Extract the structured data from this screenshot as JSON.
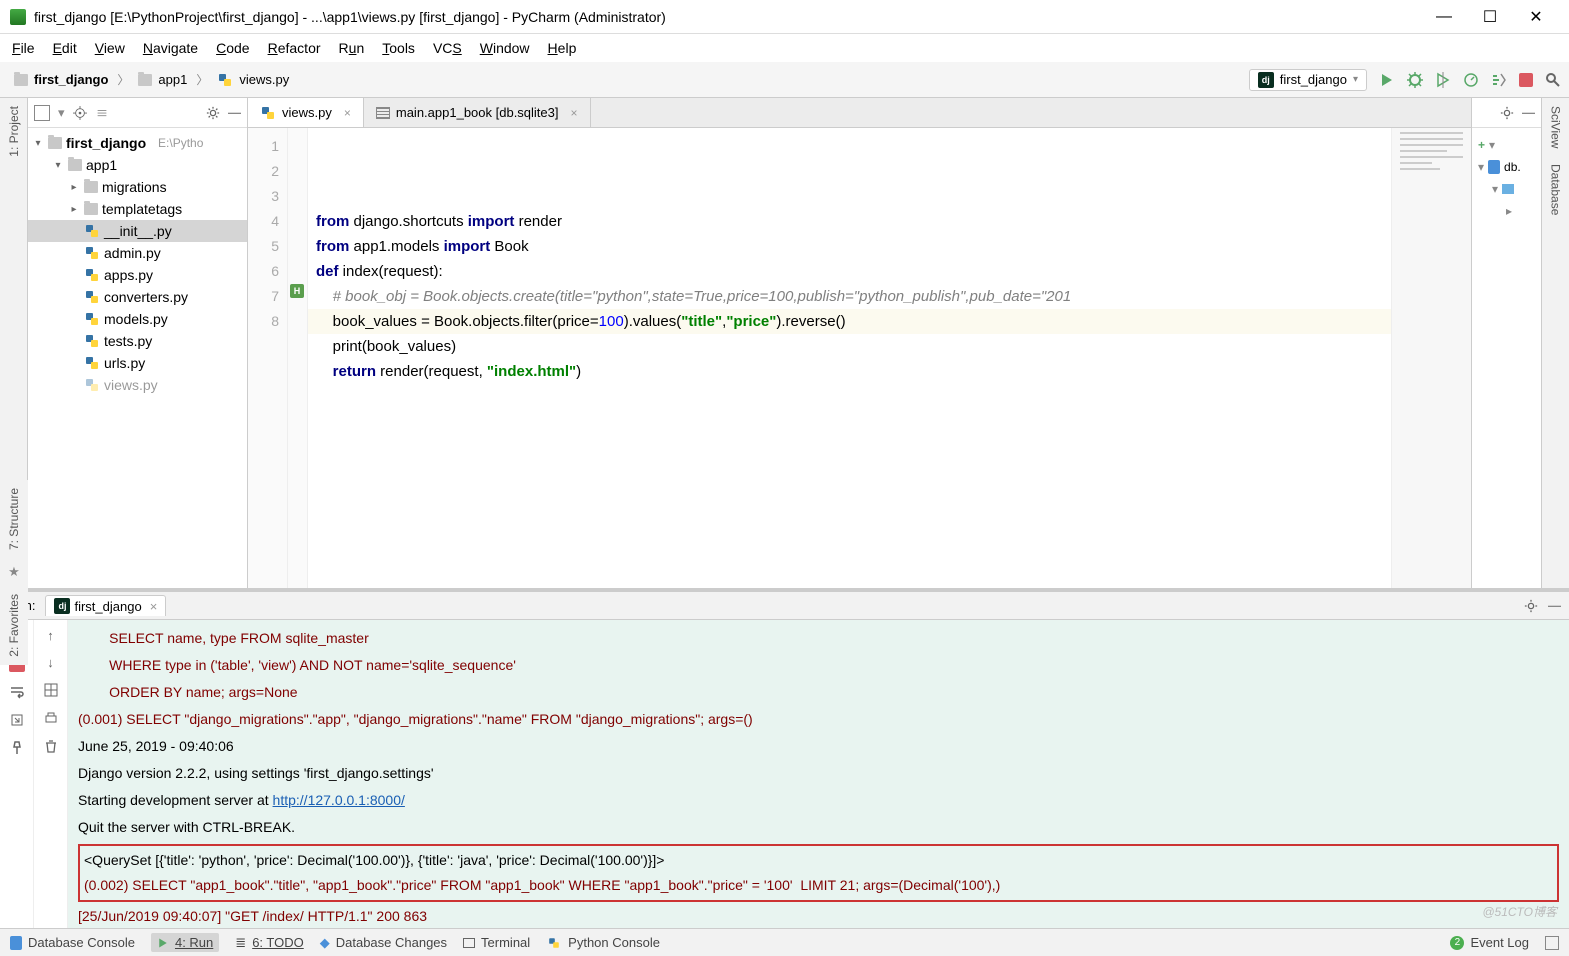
{
  "window": {
    "title": "first_django [E:\\PythonProject\\first_django] - ...\\app1\\views.py [first_django] - PyCharm (Administrator)"
  },
  "menu": [
    "File",
    "Edit",
    "View",
    "Navigate",
    "Code",
    "Refactor",
    "Run",
    "Tools",
    "VCS",
    "Window",
    "Help"
  ],
  "breadcrumbs": {
    "root": "first_django",
    "mid": "app1",
    "file": "views.py"
  },
  "run_config": {
    "name": "first_django"
  },
  "left_tabs": {
    "project": "1: Project",
    "structure": "7: Structure",
    "favorites": "2: Favorites"
  },
  "right_tabs": {
    "sciview": "SciView",
    "database": "Database"
  },
  "project_tree": {
    "root": {
      "name": "first_django",
      "path": "E:\\Pytho"
    },
    "app1": "app1",
    "migrations": "migrations",
    "templatetags": "templatetags",
    "files": [
      "__init__.py",
      "admin.py",
      "apps.py",
      "converters.py",
      "models.py",
      "tests.py",
      "urls.py",
      "views.py"
    ]
  },
  "editor": {
    "tabs": {
      "views": "views.py",
      "db": "main.app1_book [db.sqlite3]"
    },
    "line_numbers": [
      "1",
      "2",
      "3",
      "4",
      "5",
      "6",
      "7",
      "8"
    ],
    "code_html": "<span class='kw'>from</span> django.shortcuts <span class='kw'>import</span> render\n<span class='kw'>from</span> app1.models <span class='kw'>import</span> Book\n<span class='kw'>def</span> index(request):\n    <span class='cmt'># book_obj = Book.objects.create(title=\"python\",state=True,price=100,publish=\"python_publish\",pub_date=\"201</span>\n    book_values = Book.objects.filter(<span>price</span>=<span class='num'>100</span>).values(<span class='str'>\"title\"</span>,<span class='str'>\"price\"</span>).reverse()\n    print(book_values)\n    <span class='kw'>return</span> render(request, <span class='str'>\"index.html\"</span>)\n"
  },
  "db_panel": {
    "label": "db."
  },
  "run": {
    "label": "Run:",
    "tab": "first_django",
    "lines": {
      "l1": "        SELECT name, type FROM sqlite_master",
      "l2": "        WHERE type in ('table', 'view') AND NOT name='sqlite_sequence'",
      "l3": "        ORDER BY name; args=None",
      "l4": "(0.001) SELECT \"django_migrations\".\"app\", \"django_migrations\".\"name\" FROM \"django_migrations\"; args=()",
      "l5": "June 25, 2019 - 09:40:06",
      "l6": "Django version 2.2.2, using settings 'first_django.settings'",
      "l7a": "Starting development server at ",
      "l7link": "http://127.0.0.1:8000/",
      "l8": "Quit the server with CTRL-BREAK.",
      "box1": "<QuerySet [{'title': 'python', 'price': Decimal('100.00')}, {'title': 'java', 'price': Decimal('100.00')}]>",
      "box2": "(0.002) SELECT \"app1_book\".\"title\", \"app1_book\".\"price\" FROM \"app1_book\" WHERE \"app1_book\".\"price\" = '100'  LIMIT 21; args=(Decimal('100'),)",
      "l9": "[25/Jun/2019 09:40:07] \"GET /index/ HTTP/1.1\" 200 863"
    }
  },
  "statusbar": {
    "db_console": "Database Console",
    "run": "4: Run",
    "todo": "6: TODO",
    "db_changes": "Database Changes",
    "terminal": "Terminal",
    "py_console": "Python Console",
    "event_log": "Event Log",
    "event_count": "2"
  },
  "watermark": "@51CTO博客"
}
